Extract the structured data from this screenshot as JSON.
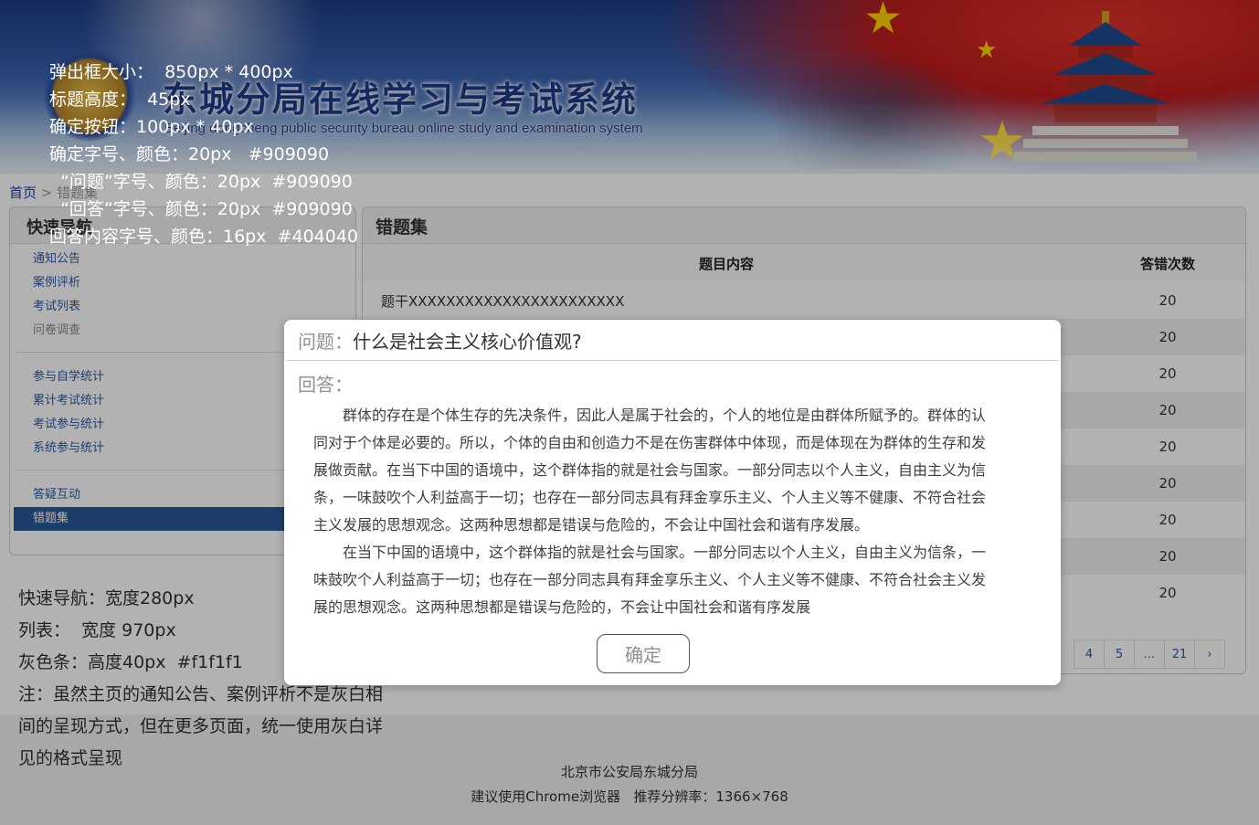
{
  "header": {
    "title": "东城分局在线学习与考试系统",
    "subtitle": "Beijing dongcheng public security bureau online study and examination system"
  },
  "breadcrumb": {
    "home": "首页",
    "separator": ">",
    "current": "错题集"
  },
  "sidebar": {
    "title": "快速导航",
    "groups": [
      [
        {
          "label": "通知公告"
        },
        {
          "label": "案例评析"
        },
        {
          "label": "考试列表"
        },
        {
          "label": "问卷调查",
          "state": "disabled"
        }
      ],
      [
        {
          "label": "参与自学统计"
        },
        {
          "label": "累计考试统计"
        },
        {
          "label": "考试参与统计"
        },
        {
          "label": "系统参与统计"
        }
      ],
      [
        {
          "label": "答疑互动"
        },
        {
          "label": "错题集",
          "state": "active"
        }
      ]
    ]
  },
  "main": {
    "title": "错题集",
    "columns": [
      "题目内容",
      "答错次数"
    ],
    "rows": [
      {
        "question": "题干XXXXXXXXXXXXXXXXXXXXXXX",
        "count": "20"
      },
      {
        "question": "",
        "count": "20"
      },
      {
        "question": "",
        "count": "20"
      },
      {
        "question": "",
        "count": "20"
      },
      {
        "question": "",
        "count": "20"
      },
      {
        "question": "",
        "count": "20"
      },
      {
        "question": "",
        "count": "20"
      },
      {
        "question": "",
        "count": "20"
      },
      {
        "question": "",
        "count": "20"
      }
    ],
    "pagination": [
      "4",
      "5",
      "...",
      "21",
      "›"
    ]
  },
  "footer": {
    "line1": "北京市公安局东城分局",
    "line2": "建议使用Chrome浏览器   推荐分辨率：1366×768"
  },
  "spec_notes_top": [
    "弹出框大小：  850px * 400px",
    "标题高度：  45px",
    "确定按钮：100px * 40px",
    "确定字号、颜色：20px   #909090",
    "  “问题”字号、颜色：20px  #909090",
    "  “回答”字号、颜色：20px  #909090",
    "回答内容字号、颜色：16px  #404040"
  ],
  "spec_notes_left": [
    "快速导航：宽度280px",
    "列表：  宽度 970px",
    "灰色条：高度40px  #f1f1f1",
    "注：虽然主页的通知公告、案例评析不是灰白相间的呈现方式，但在更多页面，统一使用灰白详见的格式呈现"
  ],
  "modal": {
    "question_label": "问题：",
    "question_text": "什么是社会主义核心价值观?",
    "answer_label": "回答：",
    "answer_paragraphs": [
      "群体的存在是个体生存的先决条件，因此人是属于社会的，个人的地位是由群体所赋予的。群体的认同对于个体是必要的。所以，个体的自由和创造力不是在伤害群体中体现，而是体现在为群体的生存和发展做贡献。在当下中国的语境中，这个群体指的就是社会与国家。一部分同志以个人主义，自由主义为信条，一味鼓吹个人利益高于一切；也存在一部分同志具有拜金享乐主义、个人主义等不健康、不符合社会主义发展的思想观念。这两种思想都是错误与危险的，不会让中国社会和谐有序发展。",
      "在当下中国的语境中，这个群体指的就是社会与国家。一部分同志以个人主义，自由主义为信条，一味鼓吹个人利益高于一切；也存在一部分同志具有拜金享乐主义、个人主义等不健康、不符合社会主义发展的思想观念。这两种思想都是错误与危险的，不会让中国社会和谐有序发展"
    ],
    "ok_label": "确定"
  },
  "colors": {
    "accent": "#2b5a99",
    "gray_bar": "#f1f1f1",
    "label_gray": "#909090",
    "body_text": "#404040"
  }
}
